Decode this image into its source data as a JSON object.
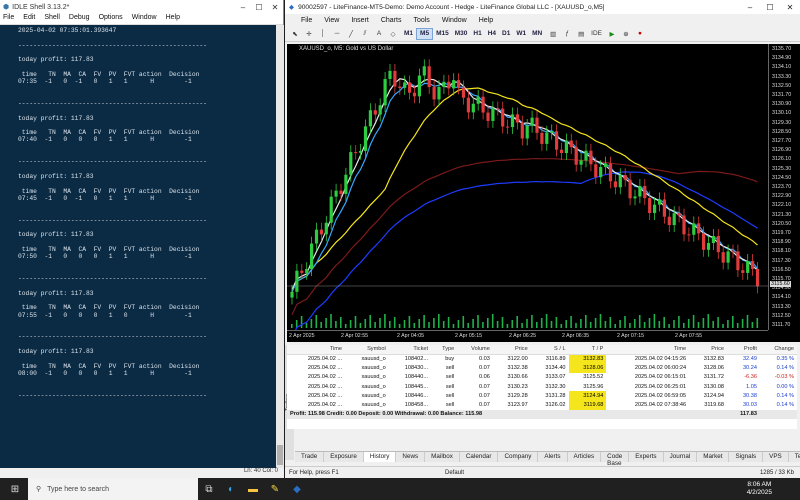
{
  "idle": {
    "title": "IDLE Shell 3.13.2*",
    "menu": [
      "File",
      "Edit",
      "Shell",
      "Debug",
      "Options",
      "Window",
      "Help"
    ],
    "lines": [
      "2025-04-02 07:35:01.393647",
      "",
      "--------------------------------------------------",
      "",
      "today profit: 117.83",
      "",
      " time   TN  MA  CA  FV  PV  FVT action  Decision",
      "07:35  -1   0  -1   0   1   1      H        -1",
      "",
      "",
      "--------------------------------------------------",
      "",
      "today profit: 117.83",
      "",
      " time   TN  MA  CA  FV  PV  FVT action  Decision",
      "07:40  -1   0   0   0   1   1      H        -1",
      "",
      "",
      "--------------------------------------------------",
      "",
      "today profit: 117.83",
      "",
      " time   TN  MA  CA  FV  PV  FVT action  Decision",
      "07:45  -1   0  -1   0   1   1      H        -1",
      "",
      "",
      "--------------------------------------------------",
      "",
      "today profit: 117.83",
      "",
      " time   TN  MA  CA  FV  PV  FVT action  Decision",
      "07:50  -1   0   0   0   1   1      H        -1",
      "",
      "",
      "--------------------------------------------------",
      "",
      "today profit: 117.83",
      "",
      " time   TN  MA  CA  FV  PV  FVT action  Decision",
      "07:55  -1   0   0   0   1   0      H        -1",
      "",
      "",
      "--------------------------------------------------",
      "",
      "today profit: 117.83",
      "",
      " time   TN  MA  CA  FV  PV  FVT action  Decision",
      "08:00  -1   0   0   0   1   1      H        -1",
      "",
      "",
      "--------------------------------------------------",
      ""
    ],
    "status": "Ln: 40   Col: 0"
  },
  "mt5": {
    "title": "90002597 - LiteFinance-MT5-Demo: Demo Account - Hedge - LiteFinance Global LLC - [XAUUSD_o,M5]",
    "menu": [
      "File",
      "View",
      "Insert",
      "Charts",
      "Tools",
      "Window",
      "Help"
    ],
    "timeframes": [
      "M1",
      "M5",
      "M15",
      "M30",
      "H1",
      "H4",
      "D1",
      "W1",
      "MN"
    ],
    "active_tf": "M5",
    "chart_label": "XAUUSD_o, M5:  Gold vs US Dollar",
    "price_labels": [
      "3135.70",
      "3134.90",
      "3134.10",
      "3133.30",
      "3132.50",
      "3131.70",
      "3130.90",
      "3130.10",
      "3129.30",
      "3128.50",
      "3127.70",
      "3126.90",
      "3126.10",
      "3125.30",
      "3124.50",
      "3123.70",
      "3122.90",
      "3122.10",
      "3121.30",
      "3120.50",
      "3119.70",
      "3118.90",
      "3118.10",
      "3117.30",
      "3116.50",
      "3115.70",
      "3114.90",
      "3114.10",
      "3113.30",
      "3112.50",
      "3111.70"
    ],
    "current_price": "3115.60",
    "time_labels": [
      "2 Apr 2025",
      "2 Apr 02:55",
      "2 Apr 04:05",
      "2 Apr 05:15",
      "2 Apr 06:25",
      "2 Apr 06:35",
      "2 Apr 07:15",
      "2 Apr 07:55"
    ],
    "trade_headers": [
      "Time",
      "Symbol",
      "Ticket",
      "Type",
      "Volume",
      "Price",
      "S / L",
      "T / P",
      "Time",
      "Price",
      "Profit",
      "Change"
    ],
    "trades": [
      [
        "2025.04.02 ...",
        "xauusd_o",
        "108402...",
        "buy",
        "0.03",
        "3122.00",
        "3116.89",
        "3132.83",
        "2025.04.02 04:15:26",
        "3132.83",
        "32.49",
        "0.35 %"
      ],
      [
        "2025.04.02 ...",
        "xauusd_o",
        "108430...",
        "sell",
        "0.07",
        "3132.38",
        "3134.40",
        "3128.06",
        "2025.04.02 06:00:24",
        "3128.06",
        "30.24",
        "0.14 %"
      ],
      [
        "2025.04.02 ...",
        "xauusd_o",
        "108440...",
        "sell",
        "0.06",
        "3130.66",
        "3133.07",
        "3125.52",
        "2025.04.02 06:15:01",
        "3131.72",
        "-6.36",
        "-0.03 %"
      ],
      [
        "2025.04.02 ...",
        "xauusd_o",
        "108445...",
        "sell",
        "0.07",
        "3130.23",
        "3132.30",
        "3125.96",
        "2025.04.02 06:25:01",
        "3130.08",
        "1.05",
        "0.00 %"
      ],
      [
        "2025.04.02 ...",
        "xauusd_o",
        "108446...",
        "sell",
        "0.07",
        "3129.28",
        "3131.28",
        "3124.94",
        "2025.04.02 06:59:05",
        "3124.94",
        "30.38",
        "0.14 %"
      ],
      [
        "2025.04.02 ...",
        "xauusd_o",
        "108458...",
        "sell",
        "0.07",
        "3123.97",
        "3126.02",
        "3119.68",
        "2025.04.02 07:38:46",
        "3119.68",
        "30.03",
        "0.14 %"
      ]
    ],
    "summary": "Profit: 115.98  Credit: 0.00  Deposit: 0.00  Withdrawal: 0.00  Balance: 115.98",
    "summary_profit": "117.83",
    "tabs": [
      "Trade",
      "Exposure",
      "History",
      "News",
      "Mailbox",
      "Calendar",
      "Company",
      "Alerts",
      "Articles",
      "Code Base",
      "Experts",
      "Journal"
    ],
    "active_tab": "History",
    "right_tabs": [
      "Market",
      "Signals",
      "VPS",
      "Tester"
    ],
    "status_left": "For Help, press F1",
    "status_mid": "Default",
    "status_right": "1285 / 33 Kb",
    "toolbox_label": "Toolbox"
  },
  "taskbar": {
    "search_placeholder": "Type here to search",
    "time": "8:06 AM",
    "date": "4/2/2025"
  }
}
